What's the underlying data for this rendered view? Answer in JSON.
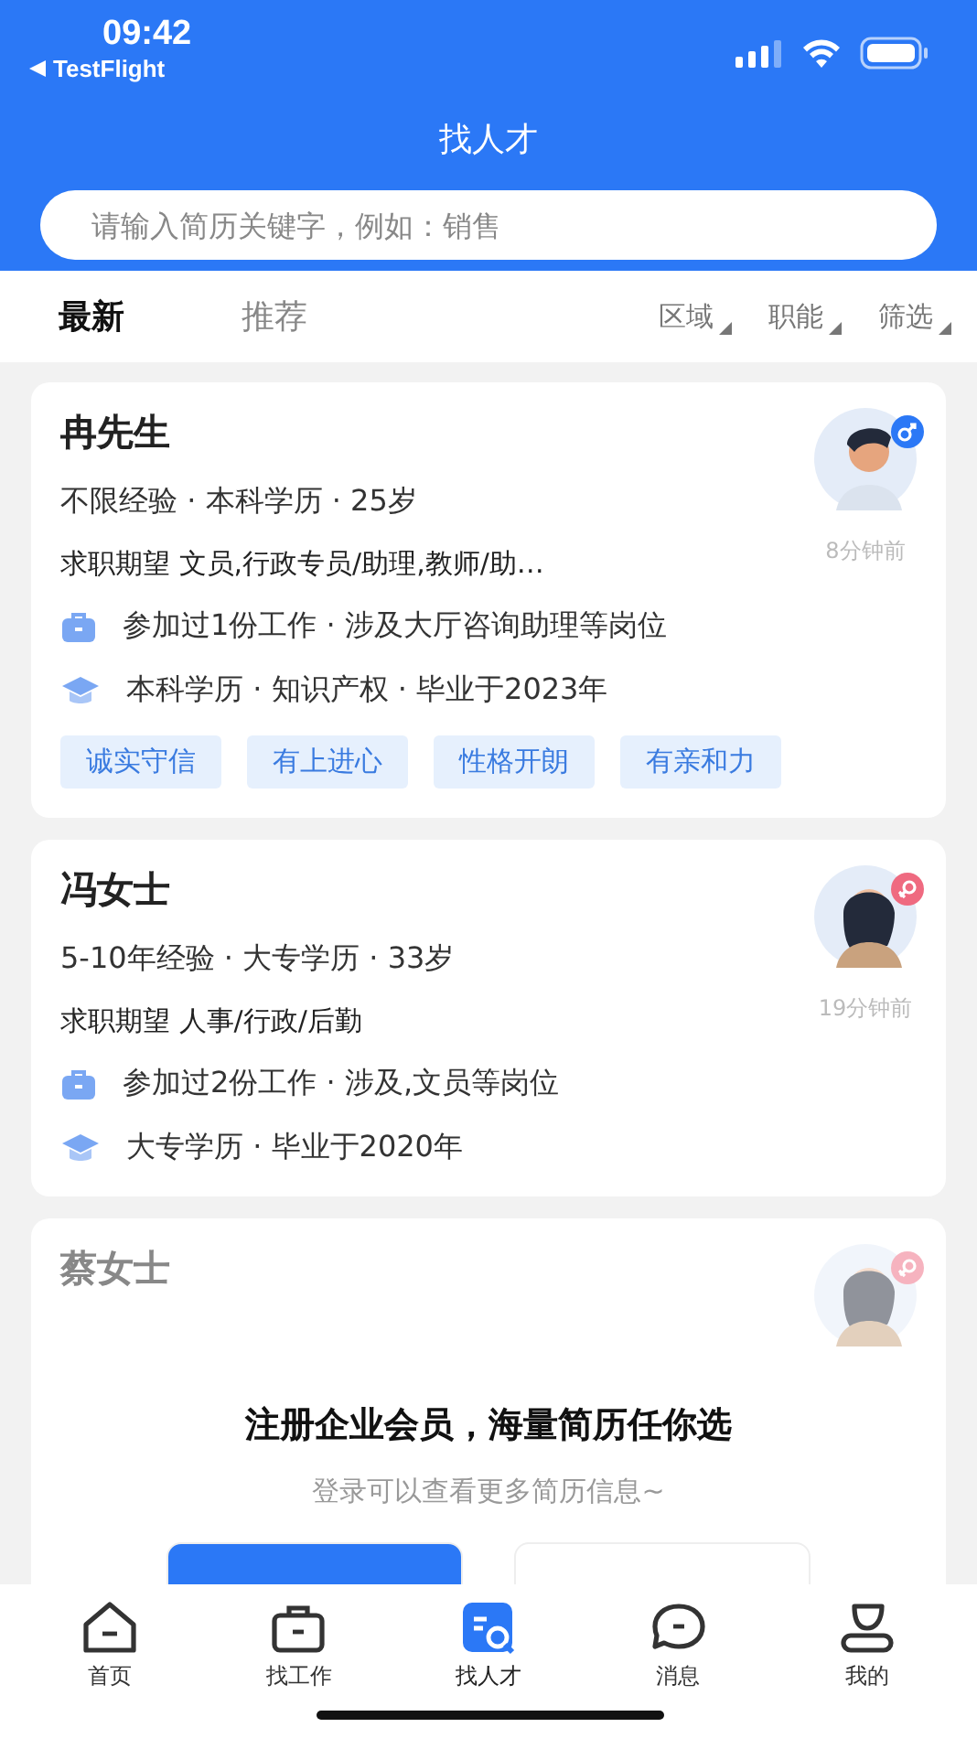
{
  "status_bar": {
    "time": "09:42",
    "back_label": "TestFlight"
  },
  "title": "找人才",
  "search": {
    "placeholder": "请输入简历关键字，例如：销售"
  },
  "tabs": [
    {
      "label": "最新",
      "selected": true
    },
    {
      "label": "推荐",
      "selected": false
    }
  ],
  "filters": [
    "区域",
    "职能",
    "筛选"
  ],
  "candidates": [
    {
      "name": "冉先生",
      "kind": "male",
      "meta": "不限经验 · 本科学历 · 25岁",
      "time": "8分钟前",
      "expectation": "求职期望 文员,行政专员/助理,教师/助…",
      "work": "参加过1份工作 · 涉及大厅咨询助理等岗位",
      "education": "本科学历 · 知识产权 · 毕业于2023年",
      "tags": [
        "诚实守信",
        "有上进心",
        "性格开朗",
        "有亲和力"
      ]
    },
    {
      "name": "冯女士",
      "kind": "female",
      "meta": "5-10年经验 · 大专学历 · 33岁",
      "time": "19分钟前",
      "expectation": "求职期望 人事/行政/后勤",
      "work": "参加过2份工作 · 涉及,文员等岗位",
      "education": "大专学历 · 毕业于2020年"
    },
    {
      "name": "蔡女士",
      "kind": "female"
    }
  ],
  "promo": {
    "title": "注册企业会员，海量简历任你选",
    "subtitle": "登录可以查看更多简历信息~"
  },
  "nav": [
    {
      "label": "首页",
      "kind": "home",
      "selected": false
    },
    {
      "label": "找工作",
      "kind": "briefcase",
      "selected": false
    },
    {
      "label": "找人才",
      "kind": "talent",
      "selected": true
    },
    {
      "label": "消息",
      "kind": "chat",
      "selected": false
    },
    {
      "label": "我的",
      "kind": "user",
      "selected": false
    }
  ]
}
